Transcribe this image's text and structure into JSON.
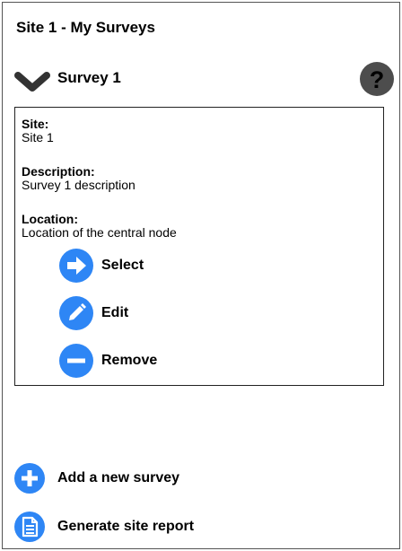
{
  "header": {
    "title": "Site 1 - My Surveys"
  },
  "survey": {
    "name": "Survey 1",
    "help_symbol": "?",
    "fields": {
      "site_label": "Site:",
      "site_value": "Site 1",
      "description_label": "Description:",
      "description_value": "Survey 1 description",
      "location_label": "Location:",
      "location_value": "Location of the central node"
    },
    "actions": {
      "select_label": "Select",
      "edit_label": "Edit",
      "remove_label": "Remove"
    }
  },
  "footer": {
    "add_label": "Add a new survey",
    "report_label": "Generate site report"
  },
  "colors": {
    "accent": "#2e86f5",
    "chevron": "#333333",
    "help_bg": "#4d4d4d"
  },
  "icons": {
    "expand": "chevron-down-icon",
    "help": "help-icon",
    "select": "arrow-right-icon",
    "edit": "pencil-icon",
    "remove": "minus-icon",
    "add": "plus-icon",
    "report": "document-icon"
  }
}
